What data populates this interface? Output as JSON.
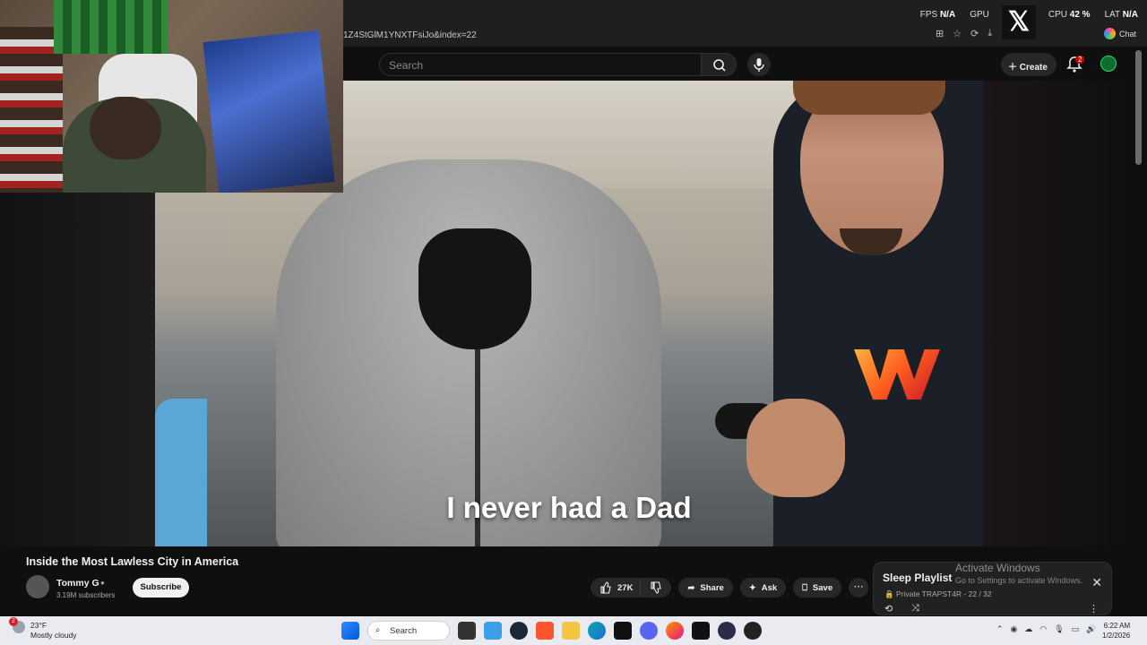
{
  "overlay_stats": {
    "fps_label": "FPS",
    "fps_value": "N/A",
    "gpu_label": "GPU",
    "cpu_label": "CPU",
    "cpu_value": "42 %",
    "lat_label": "LAT",
    "lat_value": "N/A"
  },
  "browser": {
    "url_fragment": "1Z4StGlM1YNXTFsiJo&index=22",
    "chat_label": "Chat"
  },
  "youtube_header": {
    "search_placeholder": "Search",
    "create_label": "Create",
    "notification_count": "2"
  },
  "video": {
    "subtitle": "I never had a Dad",
    "title": "Inside the Most Lawless City in America"
  },
  "channel": {
    "name": "Tommy G",
    "subscribers": "3.19M subscribers",
    "subscribe_label": "Subscribe"
  },
  "actions": {
    "likes": "27K",
    "share_label": "Share",
    "ask_label": "Ask",
    "save_label": "Save"
  },
  "playlist": {
    "title": "Sleep Playlist",
    "privacy": "Private",
    "owner": "TRAPST4R",
    "position": "22 / 32"
  },
  "windows_watermark": {
    "line1": "Activate Windows",
    "line2": "Go to Settings to activate Windows."
  },
  "taskbar": {
    "weather_temp": "23°F",
    "weather_desc": "Mostly cloudy",
    "weather_badge": "2",
    "search_label": "Search",
    "time": "6:22 AM",
    "date": "1/2/2026"
  }
}
